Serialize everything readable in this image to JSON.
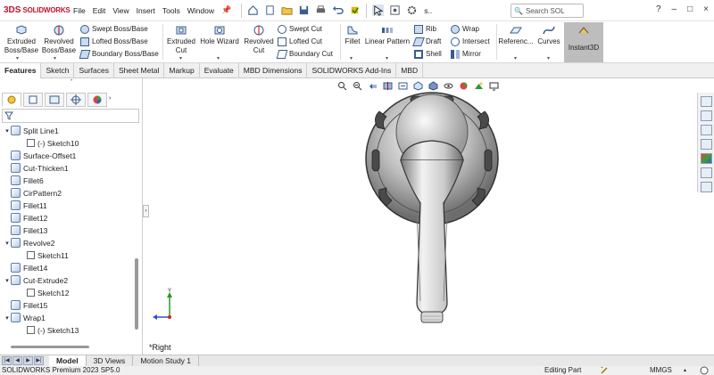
{
  "app": {
    "brand": "SOLIDWORKS",
    "brand_mark": "3DS",
    "accent": "#c8102e"
  },
  "menu": [
    "File",
    "Edit",
    "View",
    "Insert",
    "Tools",
    "Window"
  ],
  "search": {
    "placeholder": "Search SOL"
  },
  "doc_title_short": "s..",
  "ribbon": {
    "extruded_boss": "Extruded Boss/Base",
    "revolved_boss": "Revolved Boss/Base",
    "swept_boss": "Swept Boss/Base",
    "lofted_boss": "Lofted Boss/Base",
    "boundary_boss": "Boundary Boss/Base",
    "extruded_cut": "Extruded Cut",
    "hole_wizard": "Hole Wizard",
    "revolved_cut": "Revolved Cut",
    "swept_cut": "Swept Cut",
    "lofted_cut": "Lofted Cut",
    "boundary_cut": "Boundary Cut",
    "fillet": "Fillet",
    "linear_pattern": "Linear Pattern",
    "rib": "Rib",
    "draft": "Draft",
    "shell": "Shell",
    "wrap": "Wrap",
    "intersect": "Intersect",
    "mirror": "Mirror",
    "reference": "Referenc...",
    "curves": "Curves",
    "instant3d": "Instant3D"
  },
  "tabs": [
    "Features",
    "Sketch",
    "Surfaces",
    "Sheet Metal",
    "Markup",
    "Evaluate",
    "MBD Dimensions",
    "SOLIDWORKS Add-Ins",
    "MBD"
  ],
  "active_tab": "Features",
  "tree": [
    {
      "label": "Split Line1",
      "type": "feature",
      "expanded": true,
      "level": 0
    },
    {
      "label": "(-) Sketch10",
      "type": "sketch",
      "level": 1
    },
    {
      "label": "Surface-Offset1",
      "type": "feature",
      "level": 0
    },
    {
      "label": "Cut-Thicken1",
      "type": "feature",
      "level": 0
    },
    {
      "label": "Fillet6",
      "type": "feature",
      "level": 0
    },
    {
      "label": "CirPattern2",
      "type": "feature",
      "level": 0
    },
    {
      "label": "Fillet11",
      "type": "feature",
      "level": 0
    },
    {
      "label": "Fillet12",
      "type": "feature",
      "level": 0
    },
    {
      "label": "Fillet13",
      "type": "feature",
      "level": 0
    },
    {
      "label": "Revolve2",
      "type": "feature",
      "expanded": true,
      "level": 0
    },
    {
      "label": "Sketch11",
      "type": "sketch",
      "level": 1
    },
    {
      "label": "Fillet14",
      "type": "feature",
      "level": 0
    },
    {
      "label": "Cut-Extrude2",
      "type": "feature",
      "expanded": true,
      "level": 0
    },
    {
      "label": "Sketch12",
      "type": "sketch",
      "level": 1
    },
    {
      "label": "Fillet15",
      "type": "feature",
      "level": 0
    },
    {
      "label": "Wrap1",
      "type": "feature",
      "expanded": true,
      "level": 0
    },
    {
      "label": "(-) Sketch13",
      "type": "sketch",
      "level": 1
    }
  ],
  "viewport": {
    "view_label": "*Right",
    "triad_y": "Y"
  },
  "bottom_tabs": [
    "Model",
    "3D Views",
    "Motion Study 1"
  ],
  "active_bottom_tab": "Model",
  "status": {
    "version": "SOLIDWORKS Premium 2023 SP5.0",
    "mode": "Editing Part",
    "units": "MMGS"
  }
}
